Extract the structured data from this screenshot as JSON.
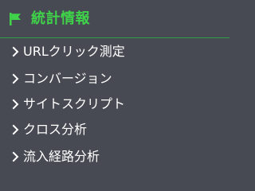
{
  "section": {
    "icon": "flag-icon",
    "title": "統計情報",
    "accent_color": "#3fd24a"
  },
  "menu": {
    "items": [
      {
        "icon": "chevron-right-icon",
        "label": "URLクリック測定"
      },
      {
        "icon": "chevron-right-icon",
        "label": "コンバージョン"
      },
      {
        "icon": "chevron-right-icon",
        "label": "サイトスクリプト"
      },
      {
        "icon": "chevron-right-icon",
        "label": "クロス分析"
      },
      {
        "icon": "chevron-right-icon",
        "label": "流入経路分析"
      }
    ]
  }
}
